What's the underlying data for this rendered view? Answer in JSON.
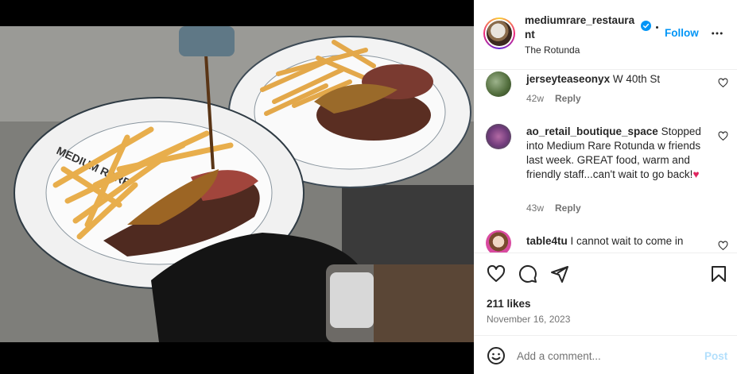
{
  "post": {
    "username": "mediumrare_restaurant",
    "follow_label": "Follow",
    "location": "The Rotunda",
    "photo_plate_text": "MEDIUM RARE"
  },
  "comments": [
    {
      "user": "jerseyteaseonyx",
      "text": "W 40th St",
      "age": "42w",
      "reply_label": "Reply"
    },
    {
      "user": "ao_retail_boutique_space",
      "text": "Stopped into Medium Rare Rotunda w friends last week. GREAT food, warm and friendly staff...can't wait to go back!",
      "emoji": "♥",
      "age": "43w",
      "reply_label": "Reply"
    },
    {
      "user": "table4tu",
      "text": "I cannot wait to come in"
    }
  ],
  "actions": {
    "likes": "211 likes",
    "date": "November 16, 2023"
  },
  "add_comment": {
    "placeholder": "Add a comment...",
    "post_label": "Post"
  },
  "icons": [
    "verified-badge-icon",
    "more-options-icon",
    "heart-icon",
    "comment-icon",
    "share-icon",
    "bookmark-icon",
    "emoji-icon"
  ],
  "colors": {
    "link_blue": "#0095f6",
    "post_disabled": "#b2dffc",
    "muted_text": "#737373"
  }
}
